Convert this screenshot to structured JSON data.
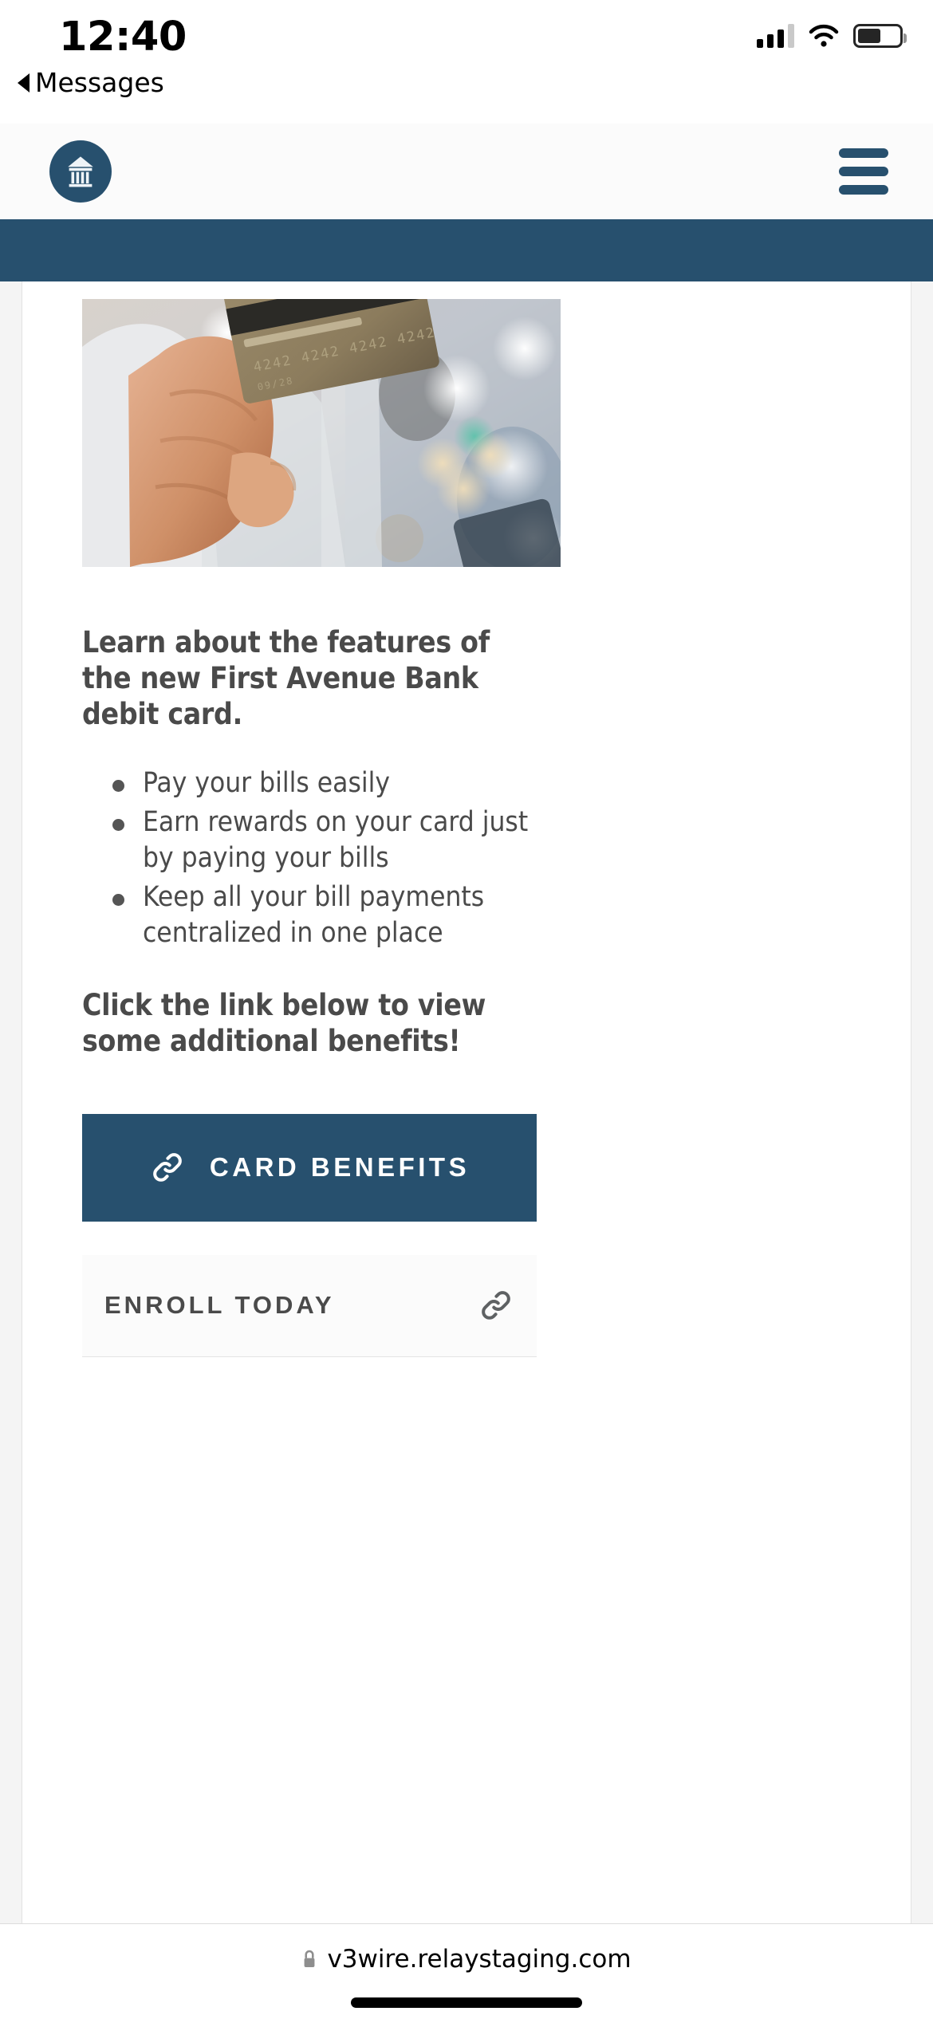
{
  "status_bar": {
    "time": "12:40",
    "back_label": "Messages",
    "signal_icon": "cellular-signal-icon",
    "wifi_icon": "wifi-icon",
    "battery_icon": "battery-icon"
  },
  "header": {
    "logo_icon": "bank-building-logo-icon",
    "menu_icon": "hamburger-menu-icon",
    "band_color": "#27506e"
  },
  "hero": {
    "image_alt": "person holding a gold debit card with blurred bokeh background"
  },
  "content": {
    "lead": "Learn about the features of the new First Avenue Bank debit card.",
    "features": [
      "Pay your bills easily",
      "Earn rewards on your card just by paying your bills",
      "Keep all your bill payments centralized in one place"
    ],
    "lead2": "Click the link below to view some additional benefits!"
  },
  "cta": {
    "label": "CARD BENEFITS",
    "icon": "link-chain-icon",
    "background": "#27506e",
    "text_color": "#ffffff"
  },
  "enroll": {
    "label": "ENROLL TODAY",
    "icon": "link-chain-icon",
    "text_color": "#4a4a4a"
  },
  "browser": {
    "lock_icon": "lock-icon",
    "url": "v3wire.relaystaging.com"
  }
}
